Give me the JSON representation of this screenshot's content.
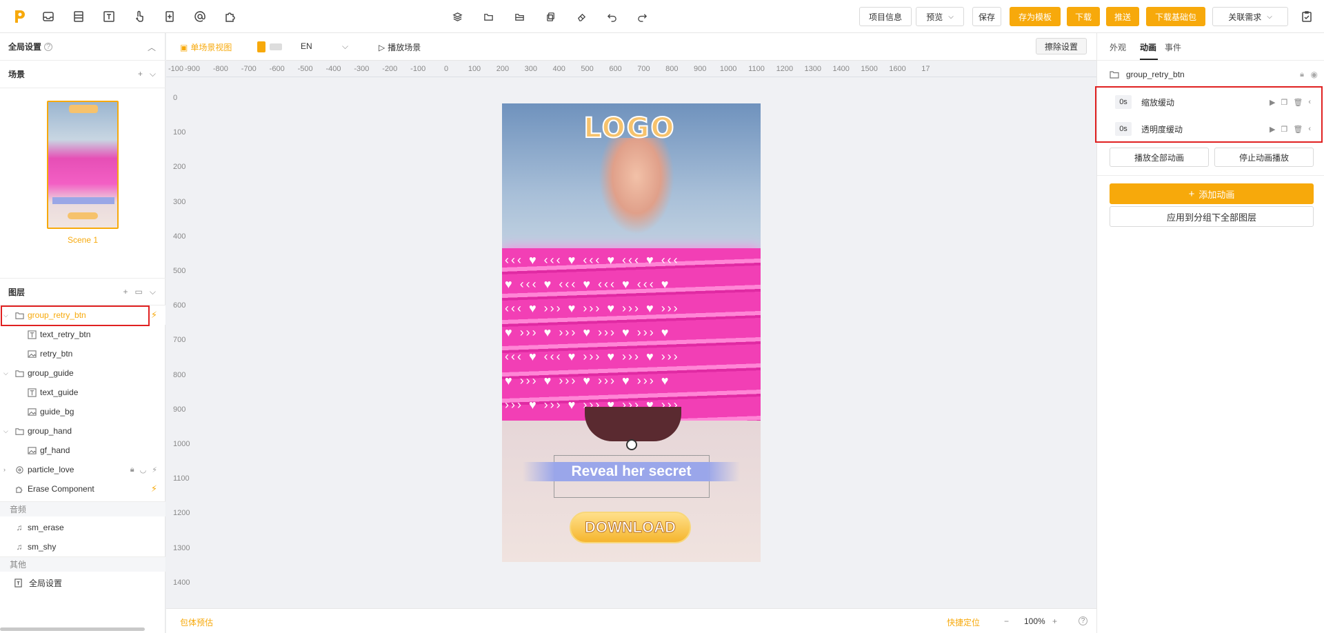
{
  "topbar": {
    "left_icons": [
      "inbox-icon",
      "layers-list-icon",
      "text-icon",
      "touch-icon",
      "component-icon",
      "at-icon",
      "puzzle-icon"
    ],
    "mid_icons": [
      "stack-icon",
      "folder-icon",
      "folder-open-icon",
      "copy-icon",
      "eraser-icon",
      "undo-icon",
      "redo-icon"
    ],
    "buttons": {
      "project_info": "项目信息",
      "preview": "预览",
      "save": "保存",
      "save_template": "存为模板",
      "download": "下载",
      "push": "推送",
      "download_base": "下载基础包",
      "related": "关联需求"
    }
  },
  "left": {
    "global_settings": "全局设置",
    "scene_header": "场景",
    "scene_name": "Scene 1",
    "layers_header": "图层",
    "layers": [
      {
        "name": "group_retry_btn",
        "type": "folder",
        "indent": 0,
        "active": true,
        "flash": true
      },
      {
        "name": "text_retry_btn",
        "type": "text",
        "indent": 1
      },
      {
        "name": "retry_btn",
        "type": "image",
        "indent": 1
      },
      {
        "name": "group_guide",
        "type": "folder",
        "indent": 0
      },
      {
        "name": "text_guide",
        "type": "text",
        "indent": 1
      },
      {
        "name": "guide_bg",
        "type": "image",
        "indent": 1
      },
      {
        "name": "group_hand",
        "type": "folder",
        "indent": 0
      },
      {
        "name": "gf_hand",
        "type": "image",
        "indent": 1
      },
      {
        "name": "particle_love",
        "type": "particle",
        "indent": 0,
        "flash": true
      },
      {
        "name": "Erase Component",
        "type": "component",
        "indent": 0,
        "flash": true
      }
    ],
    "audio_label": "音频",
    "audio": [
      "sm_erase",
      "sm_shy"
    ],
    "other_label": "其他",
    "other": [
      "全局设置"
    ]
  },
  "center": {
    "single_scene_view": "单场景视图",
    "lang": "EN",
    "play_scene": "播放场景",
    "clear_settings": "擦除设置",
    "ruler_h": [
      "-100",
      "-900",
      "-800",
      "-700",
      "-600",
      "-500",
      "-400",
      "-300",
      "-200",
      "-100",
      "0",
      "100",
      "200",
      "300",
      "400",
      "500",
      "600",
      "700",
      "800",
      "900",
      "1000",
      "1100",
      "1200",
      "1300",
      "1400",
      "1500",
      "1600",
      "17"
    ],
    "ruler_v": [
      "0",
      "100",
      "200",
      "300",
      "400",
      "500",
      "600",
      "700",
      "800",
      "900",
      "1000",
      "1100",
      "1200",
      "1300",
      "1400"
    ],
    "canvas_logo": "LOGO",
    "canvas_reveal": "Reveal her secret",
    "canvas_download": "DOWNLOAD",
    "bottom_left": "包体预估",
    "quick_locate": "快捷定位",
    "zoom": "100%"
  },
  "right": {
    "tabs": [
      "外观",
      "动画",
      "事件"
    ],
    "layer_name": "group_retry_btn",
    "animations": [
      {
        "duration": "0s",
        "name": "缩放缓动"
      },
      {
        "duration": "0s",
        "name": "透明度缓动"
      }
    ],
    "play_all": "播放全部动画",
    "stop_all": "停止动画播放",
    "add_animation": "添加动画",
    "apply_group": "应用到分组下全部图层"
  },
  "colors": {
    "accent": "#f7a90b",
    "highlight": "#e02020",
    "pink": "#f03eb0"
  }
}
